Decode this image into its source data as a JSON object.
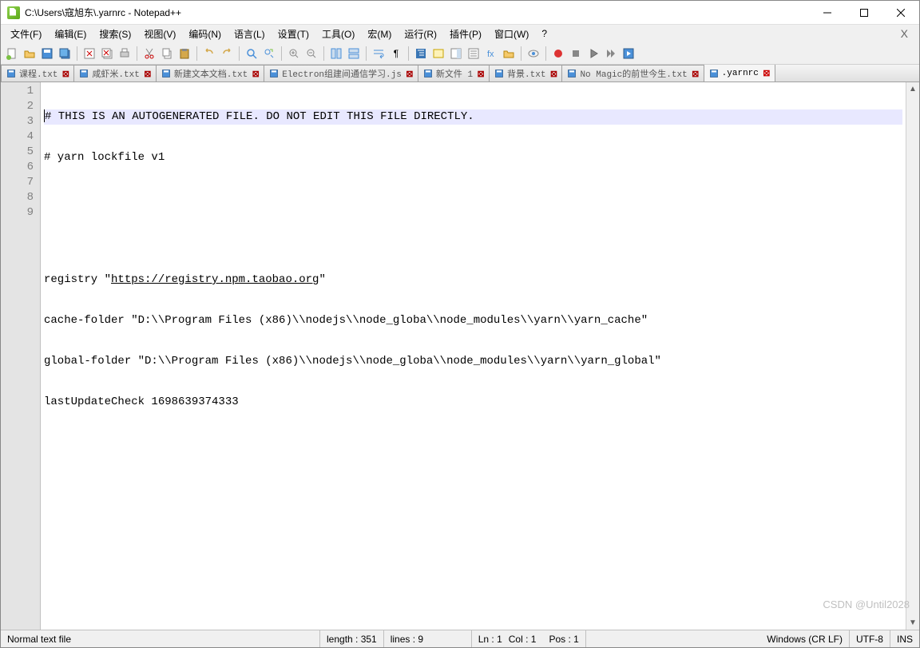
{
  "title": "C:\\Users\\寇旭东\\.yarnrc - Notepad++",
  "menus": [
    "文件(F)",
    "编辑(E)",
    "搜索(S)",
    "视图(V)",
    "编码(N)",
    "语言(L)",
    "设置(T)",
    "工具(O)",
    "宏(M)",
    "运行(R)",
    "插件(P)",
    "窗口(W)",
    "?"
  ],
  "tabs": [
    {
      "name": "课程.txt",
      "active": false
    },
    {
      "name": "咸虾米.txt",
      "active": false
    },
    {
      "name": "新建文本文档.txt",
      "active": false
    },
    {
      "name": "Electron组建间通信学习.js",
      "active": false
    },
    {
      "name": "新文件 1",
      "active": false
    },
    {
      "name": "背景.txt",
      "active": false
    },
    {
      "name": "No Magic的前世今生.txt",
      "active": false
    },
    {
      "name": ".yarnrc",
      "active": true
    }
  ],
  "gutter": [
    "1",
    "2",
    "3",
    "4",
    "5",
    "6",
    "7",
    "8",
    "9"
  ],
  "code": {
    "l1": "# THIS IS AN AUTOGENERATED FILE. DO NOT EDIT THIS FILE DIRECTLY.",
    "l2": "# yarn lockfile v1",
    "l3": "",
    "l4": "",
    "l5a": "registry \"",
    "l5link": "https://registry.npm.taobao.org",
    "l5b": "\"",
    "l6": "cache-folder \"D:\\\\Program Files (x86)\\\\nodejs\\\\node_globa\\\\node_modules\\\\yarn\\\\yarn_cache\"",
    "l7": "global-folder \"D:\\\\Program Files (x86)\\\\nodejs\\\\node_globa\\\\node_modules\\\\yarn\\\\yarn_global\"",
    "l8": "lastUpdateCheck 1698639374333",
    "l9": ""
  },
  "status": {
    "filetype": "Normal text file",
    "length": "length : 351",
    "lines": "lines : 9",
    "ln": "Ln : 1",
    "col": "Col : 1",
    "pos": "Pos : 1",
    "eol": "Windows (CR LF)",
    "encoding": "UTF-8",
    "ins": "INS"
  },
  "watermark": "CSDN @Until2028"
}
